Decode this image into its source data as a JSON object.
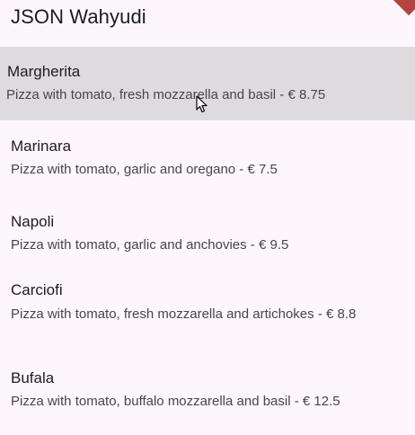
{
  "app": {
    "title": "JSON Wahyudi"
  },
  "pizzas": [
    {
      "name": "Margherita",
      "description": "Pizza with tomato, fresh mozzarella and basil - € 8.75",
      "selected": true
    },
    {
      "name": "Marinara",
      "description": "Pizza with tomato, garlic and oregano - € 7.5",
      "selected": false
    },
    {
      "name": "Napoli",
      "description": "Pizza with tomato, garlic and anchovies - € 9.5",
      "selected": false
    },
    {
      "name": "Carciofi",
      "description": "Pizza with tomato, fresh mozzarella and artichokes - € 8.8",
      "selected": false
    },
    {
      "name": "Bufala",
      "description": "Pizza with tomato, buffalo mozzarella and basil - € 12.5",
      "selected": false
    }
  ],
  "colors": {
    "background": "#fdf7fd",
    "selected_row": "#dedbde",
    "debug_banner": "#b5453c"
  }
}
